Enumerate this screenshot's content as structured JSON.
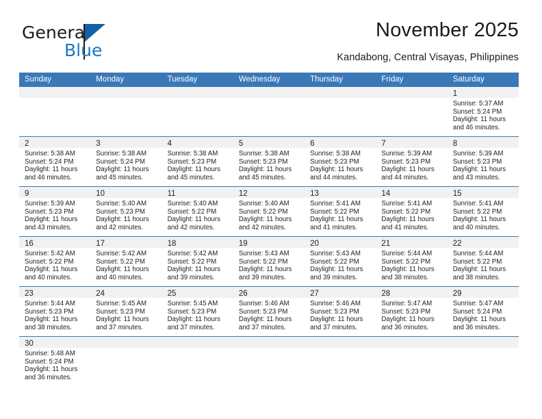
{
  "brand": {
    "name_part1": "General",
    "name_part2": "Blue",
    "flag_icon": "blue-flag-icon"
  },
  "header": {
    "title": "November 2025",
    "subtitle": "Kandabong, Central Visayas, Philippines"
  },
  "colors": {
    "header_blue": "#3a78b8",
    "brand_blue": "#1c77c3",
    "cell_header_gray": "#f1f1f1",
    "text": "#222222"
  },
  "calendar": {
    "weekday_headers": [
      "Sunday",
      "Monday",
      "Tuesday",
      "Wednesday",
      "Thursday",
      "Friday",
      "Saturday"
    ],
    "labels": {
      "sunrise": "Sunrise:",
      "sunset": "Sunset:",
      "daylight": "Daylight:"
    },
    "weeks": [
      [
        {
          "day": "",
          "sunrise": "",
          "sunset": "",
          "daylight1": "",
          "daylight2": ""
        },
        {
          "day": "",
          "sunrise": "",
          "sunset": "",
          "daylight1": "",
          "daylight2": ""
        },
        {
          "day": "",
          "sunrise": "",
          "sunset": "",
          "daylight1": "",
          "daylight2": ""
        },
        {
          "day": "",
          "sunrise": "",
          "sunset": "",
          "daylight1": "",
          "daylight2": ""
        },
        {
          "day": "",
          "sunrise": "",
          "sunset": "",
          "daylight1": "",
          "daylight2": ""
        },
        {
          "day": "",
          "sunrise": "",
          "sunset": "",
          "daylight1": "",
          "daylight2": ""
        },
        {
          "day": "1",
          "sunrise": "Sunrise: 5:37 AM",
          "sunset": "Sunset: 5:24 PM",
          "daylight1": "Daylight: 11 hours",
          "daylight2": "and 46 minutes."
        }
      ],
      [
        {
          "day": "2",
          "sunrise": "Sunrise: 5:38 AM",
          "sunset": "Sunset: 5:24 PM",
          "daylight1": "Daylight: 11 hours",
          "daylight2": "and 46 minutes."
        },
        {
          "day": "3",
          "sunrise": "Sunrise: 5:38 AM",
          "sunset": "Sunset: 5:24 PM",
          "daylight1": "Daylight: 11 hours",
          "daylight2": "and 45 minutes."
        },
        {
          "day": "4",
          "sunrise": "Sunrise: 5:38 AM",
          "sunset": "Sunset: 5:23 PM",
          "daylight1": "Daylight: 11 hours",
          "daylight2": "and 45 minutes."
        },
        {
          "day": "5",
          "sunrise": "Sunrise: 5:38 AM",
          "sunset": "Sunset: 5:23 PM",
          "daylight1": "Daylight: 11 hours",
          "daylight2": "and 45 minutes."
        },
        {
          "day": "6",
          "sunrise": "Sunrise: 5:38 AM",
          "sunset": "Sunset: 5:23 PM",
          "daylight1": "Daylight: 11 hours",
          "daylight2": "and 44 minutes."
        },
        {
          "day": "7",
          "sunrise": "Sunrise: 5:39 AM",
          "sunset": "Sunset: 5:23 PM",
          "daylight1": "Daylight: 11 hours",
          "daylight2": "and 44 minutes."
        },
        {
          "day": "8",
          "sunrise": "Sunrise: 5:39 AM",
          "sunset": "Sunset: 5:23 PM",
          "daylight1": "Daylight: 11 hours",
          "daylight2": "and 43 minutes."
        }
      ],
      [
        {
          "day": "9",
          "sunrise": "Sunrise: 5:39 AM",
          "sunset": "Sunset: 5:23 PM",
          "daylight1": "Daylight: 11 hours",
          "daylight2": "and 43 minutes."
        },
        {
          "day": "10",
          "sunrise": "Sunrise: 5:40 AM",
          "sunset": "Sunset: 5:23 PM",
          "daylight1": "Daylight: 11 hours",
          "daylight2": "and 42 minutes."
        },
        {
          "day": "11",
          "sunrise": "Sunrise: 5:40 AM",
          "sunset": "Sunset: 5:22 PM",
          "daylight1": "Daylight: 11 hours",
          "daylight2": "and 42 minutes."
        },
        {
          "day": "12",
          "sunrise": "Sunrise: 5:40 AM",
          "sunset": "Sunset: 5:22 PM",
          "daylight1": "Daylight: 11 hours",
          "daylight2": "and 42 minutes."
        },
        {
          "day": "13",
          "sunrise": "Sunrise: 5:41 AM",
          "sunset": "Sunset: 5:22 PM",
          "daylight1": "Daylight: 11 hours",
          "daylight2": "and 41 minutes."
        },
        {
          "day": "14",
          "sunrise": "Sunrise: 5:41 AM",
          "sunset": "Sunset: 5:22 PM",
          "daylight1": "Daylight: 11 hours",
          "daylight2": "and 41 minutes."
        },
        {
          "day": "15",
          "sunrise": "Sunrise: 5:41 AM",
          "sunset": "Sunset: 5:22 PM",
          "daylight1": "Daylight: 11 hours",
          "daylight2": "and 40 minutes."
        }
      ],
      [
        {
          "day": "16",
          "sunrise": "Sunrise: 5:42 AM",
          "sunset": "Sunset: 5:22 PM",
          "daylight1": "Daylight: 11 hours",
          "daylight2": "and 40 minutes."
        },
        {
          "day": "17",
          "sunrise": "Sunrise: 5:42 AM",
          "sunset": "Sunset: 5:22 PM",
          "daylight1": "Daylight: 11 hours",
          "daylight2": "and 40 minutes."
        },
        {
          "day": "18",
          "sunrise": "Sunrise: 5:42 AM",
          "sunset": "Sunset: 5:22 PM",
          "daylight1": "Daylight: 11 hours",
          "daylight2": "and 39 minutes."
        },
        {
          "day": "19",
          "sunrise": "Sunrise: 5:43 AM",
          "sunset": "Sunset: 5:22 PM",
          "daylight1": "Daylight: 11 hours",
          "daylight2": "and 39 minutes."
        },
        {
          "day": "20",
          "sunrise": "Sunrise: 5:43 AM",
          "sunset": "Sunset: 5:22 PM",
          "daylight1": "Daylight: 11 hours",
          "daylight2": "and 39 minutes."
        },
        {
          "day": "21",
          "sunrise": "Sunrise: 5:44 AM",
          "sunset": "Sunset: 5:22 PM",
          "daylight1": "Daylight: 11 hours",
          "daylight2": "and 38 minutes."
        },
        {
          "day": "22",
          "sunrise": "Sunrise: 5:44 AM",
          "sunset": "Sunset: 5:22 PM",
          "daylight1": "Daylight: 11 hours",
          "daylight2": "and 38 minutes."
        }
      ],
      [
        {
          "day": "23",
          "sunrise": "Sunrise: 5:44 AM",
          "sunset": "Sunset: 5:23 PM",
          "daylight1": "Daylight: 11 hours",
          "daylight2": "and 38 minutes."
        },
        {
          "day": "24",
          "sunrise": "Sunrise: 5:45 AM",
          "sunset": "Sunset: 5:23 PM",
          "daylight1": "Daylight: 11 hours",
          "daylight2": "and 37 minutes."
        },
        {
          "day": "25",
          "sunrise": "Sunrise: 5:45 AM",
          "sunset": "Sunset: 5:23 PM",
          "daylight1": "Daylight: 11 hours",
          "daylight2": "and 37 minutes."
        },
        {
          "day": "26",
          "sunrise": "Sunrise: 5:46 AM",
          "sunset": "Sunset: 5:23 PM",
          "daylight1": "Daylight: 11 hours",
          "daylight2": "and 37 minutes."
        },
        {
          "day": "27",
          "sunrise": "Sunrise: 5:46 AM",
          "sunset": "Sunset: 5:23 PM",
          "daylight1": "Daylight: 11 hours",
          "daylight2": "and 37 minutes."
        },
        {
          "day": "28",
          "sunrise": "Sunrise: 5:47 AM",
          "sunset": "Sunset: 5:23 PM",
          "daylight1": "Daylight: 11 hours",
          "daylight2": "and 36 minutes."
        },
        {
          "day": "29",
          "sunrise": "Sunrise: 5:47 AM",
          "sunset": "Sunset: 5:24 PM",
          "daylight1": "Daylight: 11 hours",
          "daylight2": "and 36 minutes."
        }
      ],
      [
        {
          "day": "30",
          "sunrise": "Sunrise: 5:48 AM",
          "sunset": "Sunset: 5:24 PM",
          "daylight1": "Daylight: 11 hours",
          "daylight2": "and 36 minutes."
        },
        {
          "day": "",
          "sunrise": "",
          "sunset": "",
          "daylight1": "",
          "daylight2": ""
        },
        {
          "day": "",
          "sunrise": "",
          "sunset": "",
          "daylight1": "",
          "daylight2": ""
        },
        {
          "day": "",
          "sunrise": "",
          "sunset": "",
          "daylight1": "",
          "daylight2": ""
        },
        {
          "day": "",
          "sunrise": "",
          "sunset": "",
          "daylight1": "",
          "daylight2": ""
        },
        {
          "day": "",
          "sunrise": "",
          "sunset": "",
          "daylight1": "",
          "daylight2": ""
        },
        {
          "day": "",
          "sunrise": "",
          "sunset": "",
          "daylight1": "",
          "daylight2": ""
        }
      ]
    ]
  }
}
